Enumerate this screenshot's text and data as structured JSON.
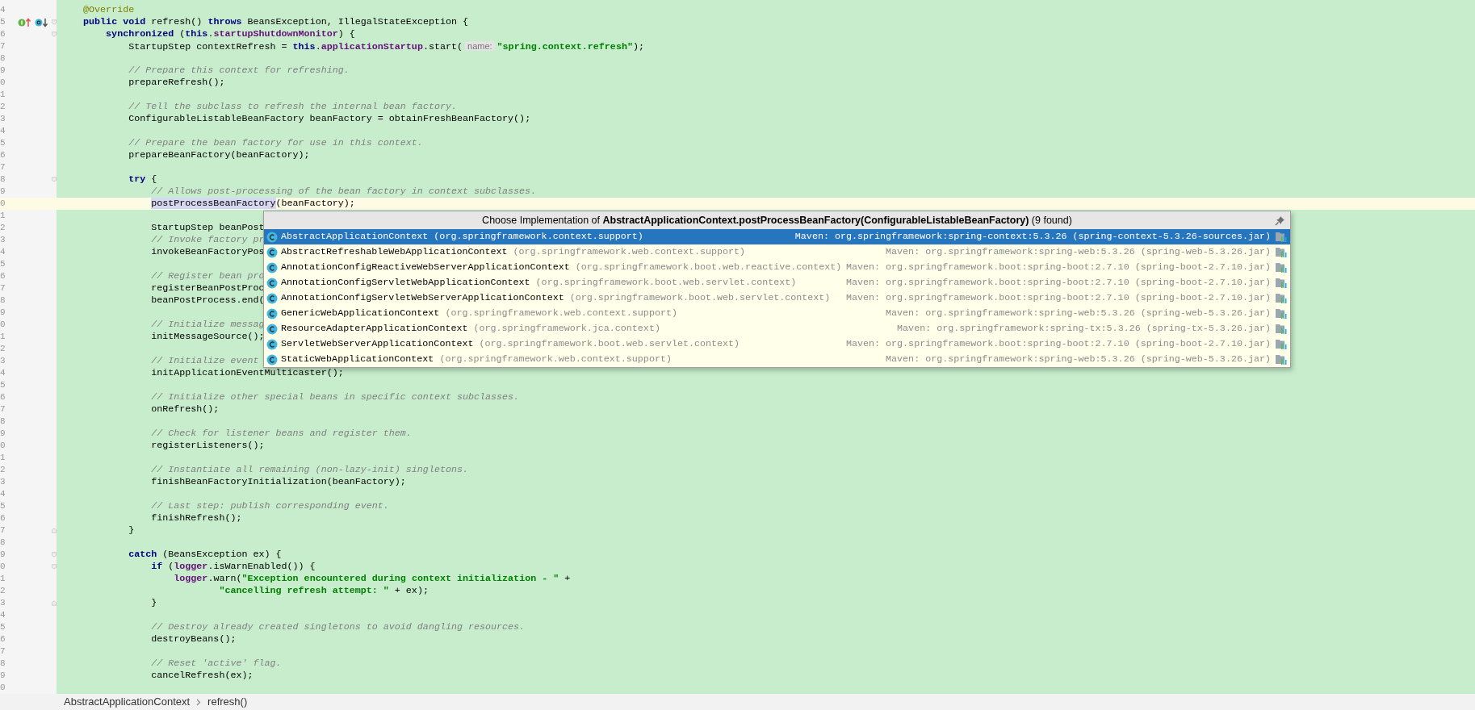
{
  "editor": {
    "lines": [
      {
        "number": "4",
        "tokens": [
          {
            "kind": "annotation",
            "text": "    @Override"
          }
        ]
      },
      {
        "number": "5",
        "implements": true,
        "overridden": true,
        "fold_start": true,
        "tokens": [
          {
            "kind": "keyword",
            "text": "    public void "
          },
          {
            "kind": "plain",
            "text": "refresh() "
          },
          {
            "kind": "keyword",
            "text": "throws "
          },
          {
            "kind": "plain",
            "text": "BeansException, IllegalStateException {"
          }
        ]
      },
      {
        "number": "6",
        "fold_start": true,
        "tokens": [
          {
            "kind": "keyword",
            "text": "        synchronized "
          },
          {
            "kind": "plain",
            "text": "("
          },
          {
            "kind": "keyword",
            "text": "this"
          },
          {
            "kind": "plain",
            "text": "."
          },
          {
            "kind": "field",
            "text": "startupShutdownMonitor"
          },
          {
            "kind": "plain",
            "text": ") {"
          }
        ]
      },
      {
        "number": "7",
        "tokens": [
          {
            "kind": "plain",
            "text": "            StartupStep contextRefresh = "
          },
          {
            "kind": "keyword",
            "text": "this"
          },
          {
            "kind": "plain",
            "text": "."
          },
          {
            "kind": "field",
            "text": "applicationStartup"
          },
          {
            "kind": "plain",
            "text": ".start("
          },
          {
            "kind": "hint",
            "text": "name:"
          },
          {
            "kind": "string",
            "text": "\"spring.context.refresh\""
          },
          {
            "kind": "plain",
            "text": ");"
          }
        ]
      },
      {
        "number": "8"
      },
      {
        "number": "9",
        "tokens": [
          {
            "kind": "comment",
            "text": "            // Prepare this context for refreshing."
          }
        ]
      },
      {
        "number": "0",
        "tokens": [
          {
            "kind": "plain",
            "text": "            prepareRefresh();"
          }
        ]
      },
      {
        "number": "1"
      },
      {
        "number": "2",
        "tokens": [
          {
            "kind": "comment",
            "text": "            // Tell the subclass to refresh the internal bean factory."
          }
        ]
      },
      {
        "number": "3",
        "tokens": [
          {
            "kind": "plain",
            "text": "            ConfigurableListableBeanFactory beanFactory = obtainFreshBeanFactory();"
          }
        ]
      },
      {
        "number": "4"
      },
      {
        "number": "5",
        "tokens": [
          {
            "kind": "comment",
            "text": "            // Prepare the bean factory for use in this context."
          }
        ]
      },
      {
        "number": "6",
        "tokens": [
          {
            "kind": "plain",
            "text": "            prepareBeanFactory(beanFactory);"
          }
        ]
      },
      {
        "number": "7"
      },
      {
        "number": "8",
        "fold_start": true,
        "tokens": [
          {
            "kind": "keyword",
            "text": "            try "
          },
          {
            "kind": "plain",
            "text": "{"
          }
        ]
      },
      {
        "number": "9",
        "tokens": [
          {
            "kind": "comment",
            "text": "                // Allows post-processing of the bean factory in context subclasses."
          }
        ]
      },
      {
        "number": "0",
        "current": true,
        "tokens": [
          {
            "kind": "highlighted",
            "text": "                postProcessBeanFactory"
          },
          {
            "kind": "plain",
            "text": "(beanFactory);"
          }
        ]
      },
      {
        "number": "1"
      },
      {
        "number": "2",
        "tokens": [
          {
            "kind": "plain",
            "text": "                StartupStep beanPost"
          }
        ]
      },
      {
        "number": "3",
        "tokens": [
          {
            "kind": "comment",
            "text": "                // Invoke factory pr"
          }
        ]
      },
      {
        "number": "4",
        "tokens": [
          {
            "kind": "plain",
            "text": "                invokeBeanFactoryPos"
          }
        ]
      },
      {
        "number": "5"
      },
      {
        "number": "6",
        "tokens": [
          {
            "kind": "comment",
            "text": "                // Register bean pro"
          }
        ]
      },
      {
        "number": "7",
        "tokens": [
          {
            "kind": "plain",
            "text": "                registerBeanPostProc"
          }
        ]
      },
      {
        "number": "8",
        "tokens": [
          {
            "kind": "plain",
            "text": "                beanPostProcess.end("
          }
        ]
      },
      {
        "number": "9"
      },
      {
        "number": "0",
        "tokens": [
          {
            "kind": "comment",
            "text": "                // Initialize messag"
          }
        ]
      },
      {
        "number": "1",
        "tokens": [
          {
            "kind": "plain",
            "text": "                initMessageSource();"
          }
        ]
      },
      {
        "number": "2"
      },
      {
        "number": "3",
        "tokens": [
          {
            "kind": "comment",
            "text": "                // Initialize event"
          }
        ]
      },
      {
        "number": "4",
        "tokens": [
          {
            "kind": "plain",
            "text": "                initApplicationEventMulticaster();"
          }
        ]
      },
      {
        "number": "5"
      },
      {
        "number": "6",
        "tokens": [
          {
            "kind": "comment",
            "text": "                // Initialize other special beans in specific context subclasses."
          }
        ]
      },
      {
        "number": "7",
        "tokens": [
          {
            "kind": "plain",
            "text": "                onRefresh();"
          }
        ]
      },
      {
        "number": "8"
      },
      {
        "number": "9",
        "tokens": [
          {
            "kind": "comment",
            "text": "                // Check for listener beans and register them."
          }
        ]
      },
      {
        "number": "0",
        "tokens": [
          {
            "kind": "plain",
            "text": "                registerListeners();"
          }
        ]
      },
      {
        "number": "1"
      },
      {
        "number": "2",
        "tokens": [
          {
            "kind": "comment",
            "text": "                // Instantiate all remaining (non-lazy-init) singletons."
          }
        ]
      },
      {
        "number": "3",
        "tokens": [
          {
            "kind": "plain",
            "text": "                finishBeanFactoryInitialization(beanFactory);"
          }
        ]
      },
      {
        "number": "4"
      },
      {
        "number": "5",
        "tokens": [
          {
            "kind": "comment",
            "text": "                // Last step: publish corresponding event."
          }
        ]
      },
      {
        "number": "6",
        "tokens": [
          {
            "kind": "plain",
            "text": "                finishRefresh();"
          }
        ]
      },
      {
        "number": "7",
        "fold_end": true,
        "tokens": [
          {
            "kind": "plain",
            "text": "            }"
          }
        ]
      },
      {
        "number": "8"
      },
      {
        "number": "9",
        "fold_start": true,
        "tokens": [
          {
            "kind": "keyword",
            "text": "            catch "
          },
          {
            "kind": "plain",
            "text": "(BeansException ex) {"
          }
        ]
      },
      {
        "number": "0",
        "fold_start": true,
        "tokens": [
          {
            "kind": "keyword",
            "text": "                if "
          },
          {
            "kind": "plain",
            "text": "("
          },
          {
            "kind": "field",
            "text": "logger"
          },
          {
            "kind": "plain",
            "text": ".isWarnEnabled()) {"
          }
        ]
      },
      {
        "number": "1",
        "tokens": [
          {
            "kind": "field",
            "text": "                    logger"
          },
          {
            "kind": "plain",
            "text": ".warn("
          },
          {
            "kind": "string",
            "text": "\"Exception encountered during context initialization - \""
          },
          {
            "kind": "plain",
            "text": " +"
          }
        ]
      },
      {
        "number": "2",
        "tokens": [
          {
            "kind": "string",
            "text": "                            \"cancelling refresh attempt: \""
          },
          {
            "kind": "plain",
            "text": " + ex);"
          }
        ]
      },
      {
        "number": "3",
        "fold_end": true,
        "tokens": [
          {
            "kind": "plain",
            "text": "                }"
          }
        ]
      },
      {
        "number": "4"
      },
      {
        "number": "5",
        "tokens": [
          {
            "kind": "comment",
            "text": "                // Destroy already created singletons to avoid dangling resources."
          }
        ]
      },
      {
        "number": "6",
        "tokens": [
          {
            "kind": "plain",
            "text": "                destroyBeans();"
          }
        ]
      },
      {
        "number": "7"
      },
      {
        "number": "8",
        "tokens": [
          {
            "kind": "comment",
            "text": "                // Reset 'active' flag."
          }
        ]
      },
      {
        "number": "9",
        "tokens": [
          {
            "kind": "plain",
            "text": "                cancelRefresh(ex);"
          }
        ]
      },
      {
        "number": "0"
      }
    ]
  },
  "popup": {
    "title": "Choose Implementation of **AbstractApplicationContext.postProcessBeanFactory(ConfigurableListableBeanFactory)** (9 found)",
    "items": [
      {
        "name": "AbstractApplicationContext",
        "package": "(org.springframework.context.support)",
        "location": "Maven: org.springframework:spring-context:5.3.26 (spring-context-5.3.26-sources.jar)",
        "selected": true
      },
      {
        "name": "AbstractRefreshableWebApplicationContext",
        "package": "(org.springframework.web.context.support)",
        "location": "Maven: org.springframework:spring-web:5.3.26 (spring-web-5.3.26.jar)",
        "selected": false
      },
      {
        "name": "AnnotationConfigReactiveWebServerApplicationContext",
        "package": "(org.springframework.boot.web.reactive.context)",
        "location": "Maven: org.springframework.boot:spring-boot:2.7.10 (spring-boot-2.7.10.jar)",
        "selected": false
      },
      {
        "name": "AnnotationConfigServletWebApplicationContext",
        "package": "(org.springframework.boot.web.servlet.context)",
        "location": "Maven: org.springframework.boot:spring-boot:2.7.10 (spring-boot-2.7.10.jar)",
        "selected": false
      },
      {
        "name": "AnnotationConfigServletWebServerApplicationContext",
        "package": "(org.springframework.boot.web.servlet.context)",
        "location": "Maven: org.springframework.boot:spring-boot:2.7.10 (spring-boot-2.7.10.jar)",
        "selected": false
      },
      {
        "name": "GenericWebApplicationContext",
        "package": "(org.springframework.web.context.support)",
        "location": "Maven: org.springframework:spring-web:5.3.26 (spring-web-5.3.26.jar)",
        "selected": false
      },
      {
        "name": "ResourceAdapterApplicationContext",
        "package": "(org.springframework.jca.context)",
        "location": "Maven: org.springframework:spring-tx:5.3.26 (spring-tx-5.3.26.jar)",
        "selected": false
      },
      {
        "name": "ServletWebServerApplicationContext",
        "package": "(org.springframework.boot.web.servlet.context)",
        "location": "Maven: org.springframework.boot:spring-boot:2.7.10 (spring-boot-2.7.10.jar)",
        "selected": false
      },
      {
        "name": "StaticWebApplicationContext",
        "package": "(org.springframework.web.context.support)",
        "location": "Maven: org.springframework:spring-web:5.3.26 (spring-web-5.3.26.jar)",
        "selected": false
      }
    ]
  },
  "breadcrumb": [
    "AbstractApplicationContext",
    "refresh()"
  ]
}
